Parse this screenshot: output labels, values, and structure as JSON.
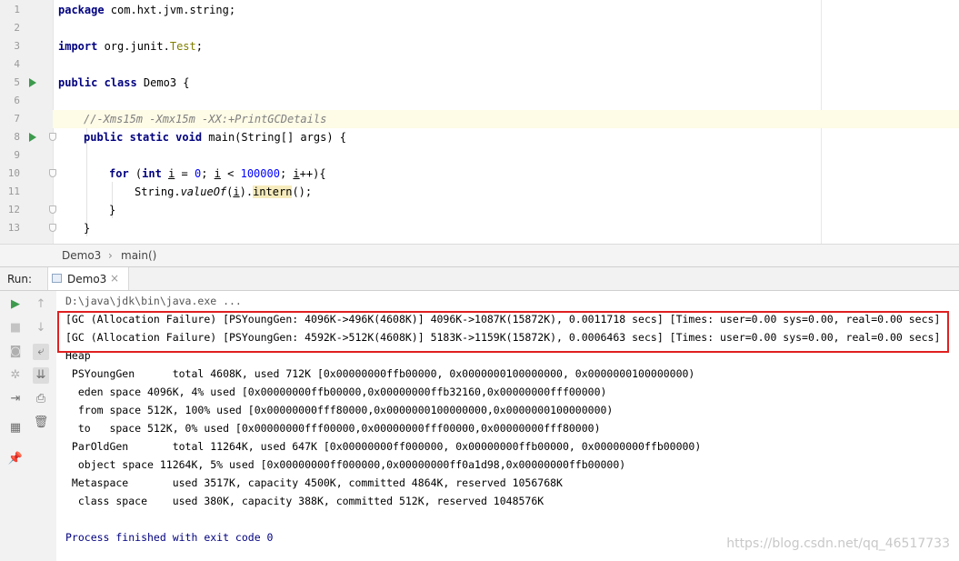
{
  "editor": {
    "line_numbers": [
      "1",
      "2",
      "3",
      "4",
      "5",
      "6",
      "7",
      "8",
      "9",
      "10",
      "11",
      "12",
      "13"
    ],
    "lines": {
      "l1_kw": "package",
      "l1_rest": " com.hxt.jvm.string;",
      "l3_kw": "import",
      "l3_pkg": " org.junit.",
      "l3_ann": "Test",
      "l3_end": ";",
      "l5_kw": "public class",
      "l5_rest": " Demo3 {",
      "l7_comment": "//-Xms15m -Xmx15m -XX:+PrintGCDetails",
      "l8_kw": "public static void",
      "l8_rest": " main(String[] args) {",
      "l10_for": "for",
      "l10_a": " (",
      "l10_int": "int",
      "l10_i1": "i",
      "l10_b": " = ",
      "l10_zero": "0",
      "l10_c": "; ",
      "l10_i2": "i",
      "l10_d": " < ",
      "l10_max": "100000",
      "l10_e": "; ",
      "l10_i3": "i",
      "l10_f": "++){",
      "l11_a": "String.",
      "l11_valueof": "valueOf",
      "l11_b": "(",
      "l11_i": "i",
      "l11_c": ").",
      "l11_intern": "intern",
      "l11_d": "();",
      "l12": "}",
      "l13": "}"
    }
  },
  "breadcrumb": {
    "class_name": "Demo3",
    "separator": "›",
    "method_name": "main()"
  },
  "run_panel": {
    "label": "Run:",
    "tab_label": "Demo3",
    "tab_close": "×"
  },
  "toolbar_icons": [
    "rerun-icon",
    "up-arrow-icon",
    "stop-icon",
    "down-arrow-icon",
    "camera-icon",
    "soft-wrap-icon",
    "settings-icon",
    "scroll-to-end-icon",
    "login-icon",
    "print-icon",
    "layout-icon",
    "trash-icon",
    "pin-icon"
  ],
  "console": {
    "lines": [
      "D:\\java\\jdk\\bin\\java.exe ...",
      "[GC (Allocation Failure) [PSYoungGen: 4096K->496K(4608K)] 4096K->1087K(15872K), 0.0011718 secs] [Times: user=0.00 sys=0.00, real=0.00 secs]",
      "[GC (Allocation Failure) [PSYoungGen: 4592K->512K(4608K)] 5183K->1159K(15872K), 0.0006463 secs] [Times: user=0.00 sys=0.00, real=0.00 secs]",
      "Heap",
      " PSYoungGen      total 4608K, used 712K [0x00000000ffb00000, 0x0000000100000000, 0x0000000100000000)",
      "  eden space 4096K, 4% used [0x00000000ffb00000,0x00000000ffb32160,0x00000000fff00000)",
      "  from space 512K, 100% used [0x00000000fff80000,0x0000000100000000,0x0000000100000000)",
      "  to   space 512K, 0% used [0x00000000fff00000,0x00000000fff00000,0x00000000fff80000)",
      " ParOldGen       total 11264K, used 647K [0x00000000ff000000, 0x00000000ffb00000, 0x00000000ffb00000)",
      "  object space 11264K, 5% used [0x00000000ff000000,0x00000000ff0a1d98,0x00000000ffb00000)",
      " Metaspace       used 3517K, capacity 4500K, committed 4864K, reserved 1056768K",
      "  class space    used 380K, capacity 388K, committed 512K, reserved 1048576K",
      "",
      "Process finished with exit code 0"
    ]
  },
  "watermark": "https://blog.csdn.net/qq_46517733",
  "colors": {
    "highlight_box": "#e02020",
    "keyword": "#000080",
    "run_green": "#3c9a4d"
  }
}
